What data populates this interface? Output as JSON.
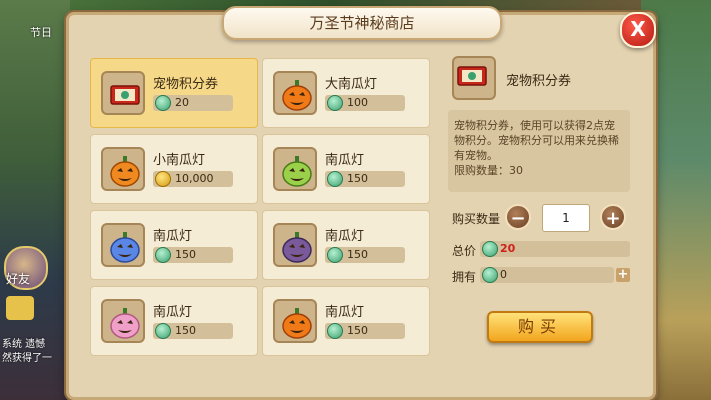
{
  "window": {
    "title": "万圣节神秘商店",
    "close_label": "X"
  },
  "items": [
    {
      "name": "宠物积分券",
      "price": "20",
      "currency": "green-coin",
      "icon": "ticket-icon",
      "selected": true
    },
    {
      "name": "大南瓜灯",
      "price": "100",
      "currency": "green-coin",
      "icon": "orange-pumpkin-icon"
    },
    {
      "name": "小南瓜灯",
      "price": "10,000",
      "currency": "gold-coin",
      "icon": "small-pumpkin-icon"
    },
    {
      "name": "南瓜灯",
      "price": "150",
      "currency": "green-coin",
      "icon": "green-pumpkin-icon"
    },
    {
      "name": "南瓜灯",
      "price": "150",
      "currency": "green-coin",
      "icon": "blue-pumpkin-icon"
    },
    {
      "name": "南瓜灯",
      "price": "150",
      "currency": "green-coin",
      "icon": "purple-pumpkin-icon"
    },
    {
      "name": "南瓜灯",
      "price": "150",
      "currency": "green-coin",
      "icon": "pink-pumpkin-icon"
    },
    {
      "name": "南瓜灯",
      "price": "150",
      "currency": "green-coin",
      "icon": "orange-pumpkin-icon"
    }
  ],
  "detail": {
    "name": "宠物积分券",
    "description": "宠物积分券，使用可以获得2点宠物积分。宠物积分可以用来兑换稀有宠物。",
    "limit": "限购数量：30",
    "quantity_label": "购买数量",
    "quantity": "1",
    "total_label": "总价",
    "total": "20",
    "owned_label": "拥有",
    "owned": "0",
    "buy_label": "购买"
  },
  "hud": {
    "top_left": "节日",
    "friend_label": "好友",
    "chat_line1": "系统 遗憾",
    "chat_line2": "然获得了一"
  },
  "colors": {
    "panel": "#e4d3b1",
    "selected_card": "#f6d889",
    "buy_button": "#f2a51d",
    "close_button": "#b41a12",
    "total_price": "#d0201a"
  }
}
